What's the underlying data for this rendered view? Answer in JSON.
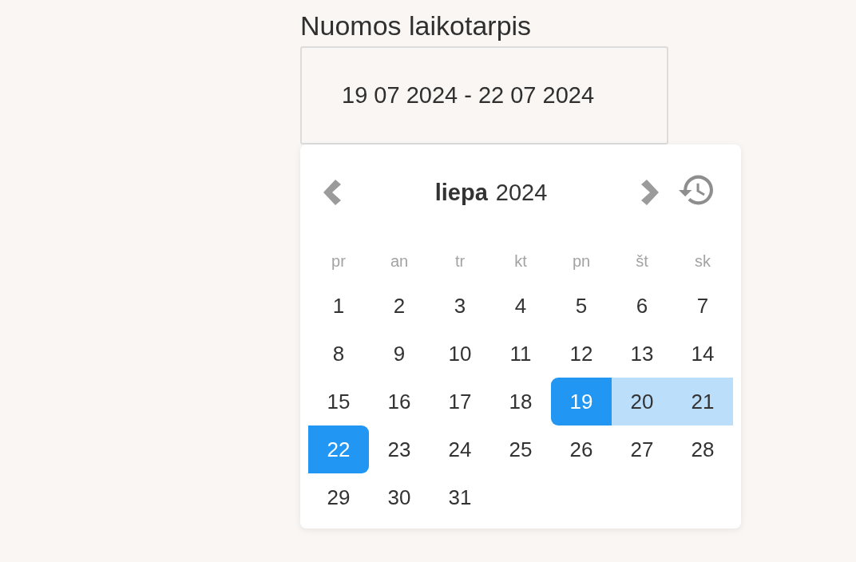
{
  "rental_period": {
    "label": "Nuomos laikotarpis",
    "value": "19 07 2024 - 22 07 2024"
  },
  "calendar": {
    "month": "liepa",
    "year": "2024",
    "weekdays": [
      "pr",
      "an",
      "tr",
      "kt",
      "pn",
      "št",
      "sk"
    ],
    "days": [
      {
        "day": "1",
        "selected": false,
        "in_range": false
      },
      {
        "day": "2",
        "selected": false,
        "in_range": false
      },
      {
        "day": "3",
        "selected": false,
        "in_range": false
      },
      {
        "day": "4",
        "selected": false,
        "in_range": false
      },
      {
        "day": "5",
        "selected": false,
        "in_range": false
      },
      {
        "day": "6",
        "selected": false,
        "in_range": false
      },
      {
        "day": "7",
        "selected": false,
        "in_range": false
      },
      {
        "day": "8",
        "selected": false,
        "in_range": false
      },
      {
        "day": "9",
        "selected": false,
        "in_range": false
      },
      {
        "day": "10",
        "selected": false,
        "in_range": false
      },
      {
        "day": "11",
        "selected": false,
        "in_range": false
      },
      {
        "day": "12",
        "selected": false,
        "in_range": false
      },
      {
        "day": "13",
        "selected": false,
        "in_range": false
      },
      {
        "day": "14",
        "selected": false,
        "in_range": false
      },
      {
        "day": "15",
        "selected": false,
        "in_range": false
      },
      {
        "day": "16",
        "selected": false,
        "in_range": false
      },
      {
        "day": "17",
        "selected": false,
        "in_range": false
      },
      {
        "day": "18",
        "selected": false,
        "in_range": false
      },
      {
        "day": "19",
        "selected": true,
        "in_range": true
      },
      {
        "day": "20",
        "selected": false,
        "in_range": true
      },
      {
        "day": "21",
        "selected": false,
        "in_range": true
      },
      {
        "day": "22",
        "selected": true,
        "in_range": true
      },
      {
        "day": "23",
        "selected": false,
        "in_range": false
      },
      {
        "day": "24",
        "selected": false,
        "in_range": false
      },
      {
        "day": "25",
        "selected": false,
        "in_range": false
      },
      {
        "day": "26",
        "selected": false,
        "in_range": false
      },
      {
        "day": "27",
        "selected": false,
        "in_range": false
      },
      {
        "day": "28",
        "selected": false,
        "in_range": false
      },
      {
        "day": "29",
        "selected": false,
        "in_range": false
      },
      {
        "day": "30",
        "selected": false,
        "in_range": false
      },
      {
        "day": "31",
        "selected": false,
        "in_range": false
      }
    ]
  }
}
